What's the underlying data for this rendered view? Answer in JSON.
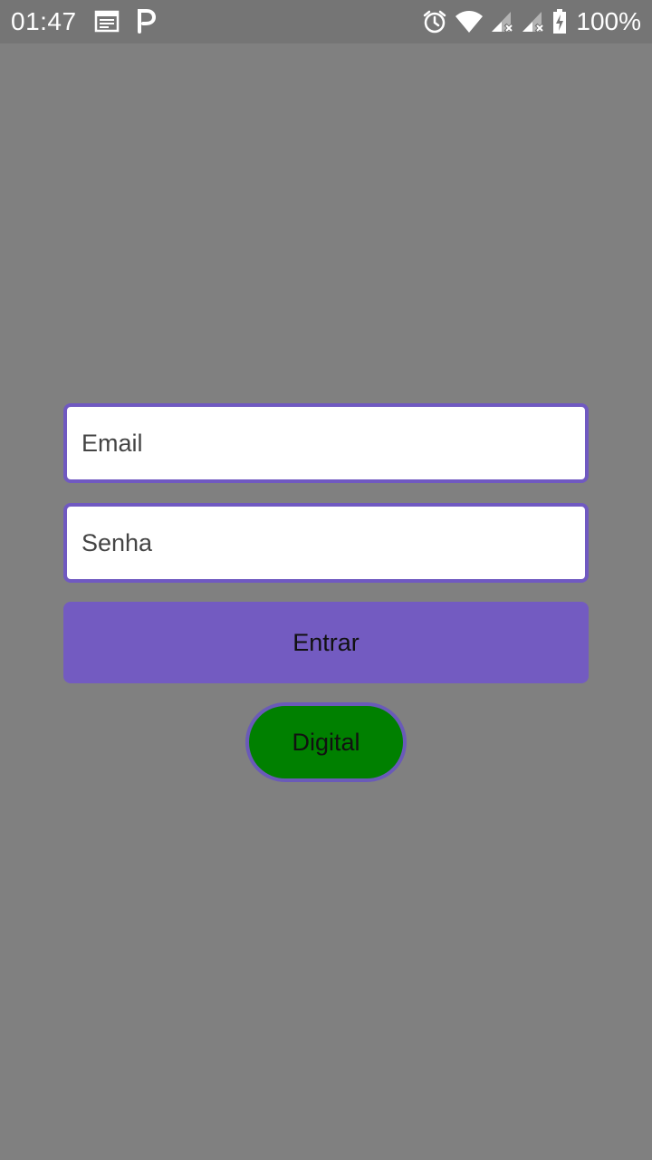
{
  "status_bar": {
    "time": "01:47",
    "battery_percent": "100%",
    "icons": [
      "calendar-icon",
      "parking-p-icon",
      "alarm-icon",
      "wifi-icon",
      "signal-icon",
      "signal-icon",
      "battery-charging-icon"
    ]
  },
  "login": {
    "email_placeholder": "Email",
    "email_value": "",
    "password_placeholder": "Senha",
    "password_value": "",
    "submit_label": "Entrar",
    "biometric_label": "Digital"
  },
  "colors": {
    "background": "#808080",
    "status_bar": "#757575",
    "accent": "#735bc1",
    "biometric_button": "#008000"
  }
}
